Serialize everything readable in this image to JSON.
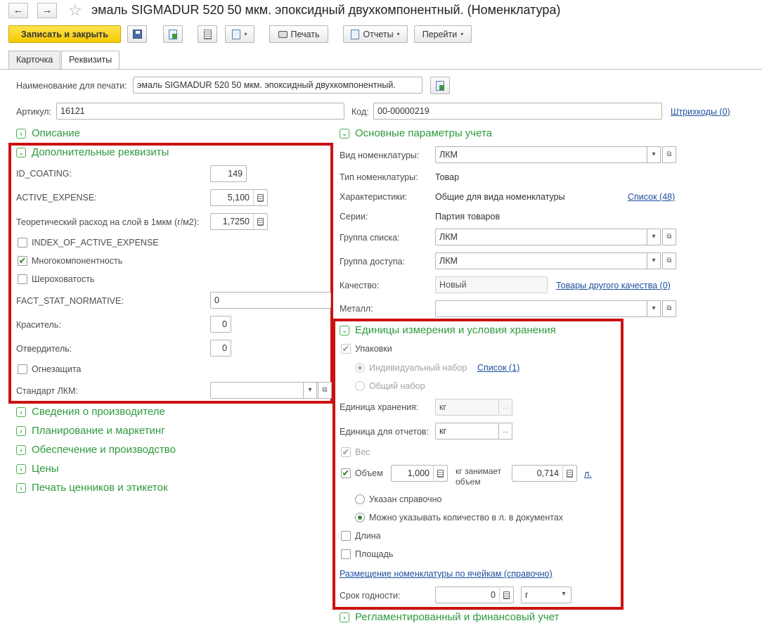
{
  "window": {
    "title": "эмаль SIGMADUR 520  50 мкм. эпоксидный двухкомпонентный. (Номенклатура)",
    "back_glyph": "←",
    "forward_glyph": "→",
    "star_glyph": "☆"
  },
  "toolbar": {
    "save_close": "Записать и закрыть",
    "print": "Печать",
    "reports": "Отчеты",
    "goto": "Перейти",
    "caret": "▾"
  },
  "tabs": [
    {
      "label": "Карточка",
      "active": false
    },
    {
      "label": "Реквизиты",
      "active": true
    }
  ],
  "header": {
    "print_name_label": "Наименование для печати:",
    "print_name_value": "эмаль SIGMADUR 520  50 мкм. эпоксидный двухкомпонентный.",
    "article_label": "Артикул:",
    "article_value": "16121",
    "code_label": "Код:",
    "code_value": "00-00000219",
    "barcodes_link": "Штрихкоды (0)"
  },
  "left": {
    "description_section": "Описание",
    "extra_section": "Дополнительные реквизиты",
    "id_coating_label": "ID_COATING:",
    "id_coating_value": "149",
    "active_expense_label": "ACTIVE_EXPENSE:",
    "active_expense_value": "5,100",
    "theor_label": "Теоретический расход на слой в 1мкм (г/м2):",
    "theor_value": "1,7250",
    "index_label": "INDEX_OF_ACTIVE_EXPENSE",
    "multicomp_label": "Многокомпонентность",
    "roughness_label": "Шероховатость",
    "fact_label": "FACT_STAT_NORMATIVE:",
    "fact_value": "0",
    "dye_label": "Краситель:",
    "dye_value": "0",
    "hardener_label": "Отвердитель:",
    "hardener_value": "0",
    "fireproof_label": "Огнезащита",
    "standard_label": "Стандарт ЛКМ:",
    "standard_value": "",
    "sections": [
      "Сведения о производителе",
      "Планирование и маркетинг",
      "Обеспечение и производство",
      "Цены",
      "Печать ценников и этикеток"
    ],
    "checkmark": "✔"
  },
  "right": {
    "main_section": "Основные параметры учета",
    "kind_label": "Вид номенклатуры:",
    "kind_value": "ЛКМ",
    "type_label": "Тип номенклатуры:",
    "type_value": "Товар",
    "char_label": "Характеристики:",
    "char_value": "Общие для вида номенклатуры",
    "char_link": "Список (48)",
    "series_label": "Серии:",
    "series_value": "Партия товаров",
    "list_group_label": "Группа списка:",
    "list_group_value": "ЛКМ",
    "access_group_label": "Группа доступа:",
    "access_group_value": "ЛКМ",
    "quality_label": "Качество:",
    "quality_value": "Новый",
    "quality_link": "Товары другого качества (0)",
    "metal_label": "Металл:",
    "metal_value": ""
  },
  "units": {
    "section": "Единицы измерения и условия хранения",
    "packages_label": "Упаковки",
    "individual_label": "Индивидуальный набор",
    "individual_link": "Список (1)",
    "common_label": "Общий набор",
    "storage_unit_label": "Единица хранения:",
    "storage_unit_value": "кг",
    "report_unit_label": "Единица для отчетов:",
    "report_unit_value": "кг",
    "weight_label": "Вес",
    "volume_label": "Объем",
    "volume_value": "1,000",
    "kg_occupies_line1": "кг занимает",
    "kg_occupies_line2": "объем",
    "occupies_value": "0,714",
    "liter_link": "л.",
    "specified_label": "Указан справочно",
    "can_specify_label": "Можно указывать количество в л. в документах",
    "length_label": "Длина",
    "area_label": "Площадь",
    "placement_link": "Размещение номенклатуры по ячейкам (справочно)",
    "shelf_life_label": "Срок годности:",
    "shelf_life_value": "0",
    "shelf_life_unit": "г",
    "ellipsis": "..."
  },
  "bottom": {
    "regulated_section": "Регламентированный и финансовый учет"
  },
  "colors": {
    "accent_green": "#2e9a3e",
    "highlight_red": "#cc1111",
    "primary_yellow": "#f6c800",
    "link_blue": "#1d4f9e"
  }
}
